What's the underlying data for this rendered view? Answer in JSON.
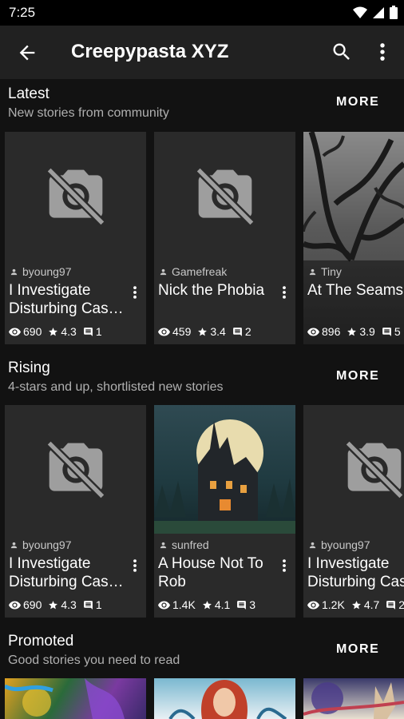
{
  "status_bar": {
    "time": "7:25"
  },
  "app_bar": {
    "title": "Creepypasta XYZ"
  },
  "sections": [
    {
      "title": "Latest",
      "subtitle": "New stories from community",
      "more": "MORE",
      "cards": [
        {
          "author": "byoung97",
          "title1": "I Investigate",
          "title2": "Disturbing Cas…",
          "views": "690",
          "rating": "4.3",
          "comments": "1",
          "image": "placeholder"
        },
        {
          "author": "Gamefreak",
          "title1": "Nick the Phobia",
          "title2": "",
          "views": "459",
          "rating": "3.4",
          "comments": "2",
          "image": "placeholder"
        },
        {
          "author": "Tiny",
          "title1": "At The Seams",
          "title2": "",
          "views": "896",
          "rating": "3.9",
          "comments": "5",
          "image": "dark-branches"
        }
      ]
    },
    {
      "title": "Rising",
      "subtitle": "4-stars and up, shortlisted new stories",
      "more": "MORE",
      "cards": [
        {
          "author": "byoung97",
          "title1": "I Investigate",
          "title2": "Disturbing Cas…",
          "views": "690",
          "rating": "4.3",
          "comments": "1",
          "image": "placeholder"
        },
        {
          "author": "sunfred",
          "title1": "A House Not To",
          "title2": "Rob",
          "views": "1.4K",
          "rating": "4.1",
          "comments": "3",
          "image": "haunted-house"
        },
        {
          "author": "byoung97",
          "title1": "I Investigate",
          "title2": "Disturbing Cas",
          "views": "1.2K",
          "rating": "4.7",
          "comments": "2",
          "image": "placeholder"
        }
      ]
    },
    {
      "title": "Promoted",
      "subtitle": "Good stories you need to read",
      "more": "MORE"
    }
  ],
  "colors": {
    "background": "#121212",
    "app_bar": "#212121",
    "card": "#2a2a2a",
    "secondary_text": "#b0b0b0"
  }
}
